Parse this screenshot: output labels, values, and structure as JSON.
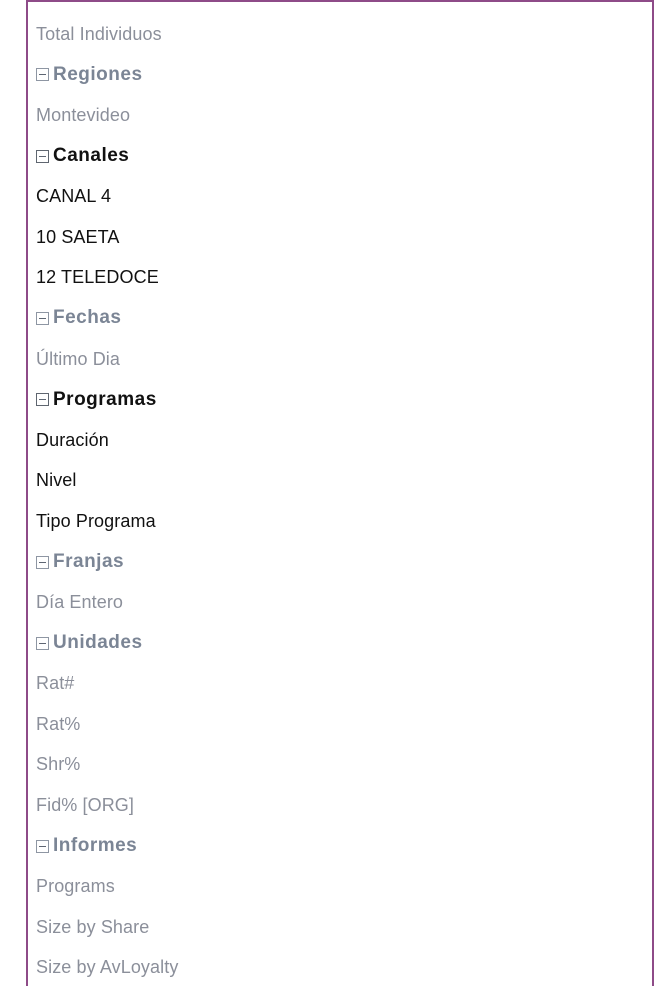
{
  "tree": {
    "total": "Total Individuos",
    "regiones": {
      "label": "Regiones",
      "items": [
        "Montevideo"
      ]
    },
    "canales": {
      "label": "Canales",
      "items": [
        "CANAL 4",
        "10 SAETA",
        "12 TELEDOCE"
      ]
    },
    "fechas": {
      "label": "Fechas",
      "items": [
        "Último Dia"
      ]
    },
    "programas": {
      "label": "Programas",
      "items": [
        "Duración",
        "Nivel",
        "Tipo Programa"
      ]
    },
    "franjas": {
      "label": "Franjas",
      "items": [
        "Día Entero"
      ]
    },
    "unidades": {
      "label": "Unidades",
      "items": [
        "Rat#",
        "Rat%",
        "Shr%",
        "Fid% [ORG]"
      ]
    },
    "informes": {
      "label": "Informes",
      "items": [
        "Programs",
        "Size by Share",
        "Size by AvLoyalty"
      ]
    }
  },
  "colors": {
    "border": "#8e4b88",
    "muted_text": "#8b8f9a",
    "active_text": "#111111"
  },
  "icons": {
    "collapse": "minus-box-icon"
  }
}
